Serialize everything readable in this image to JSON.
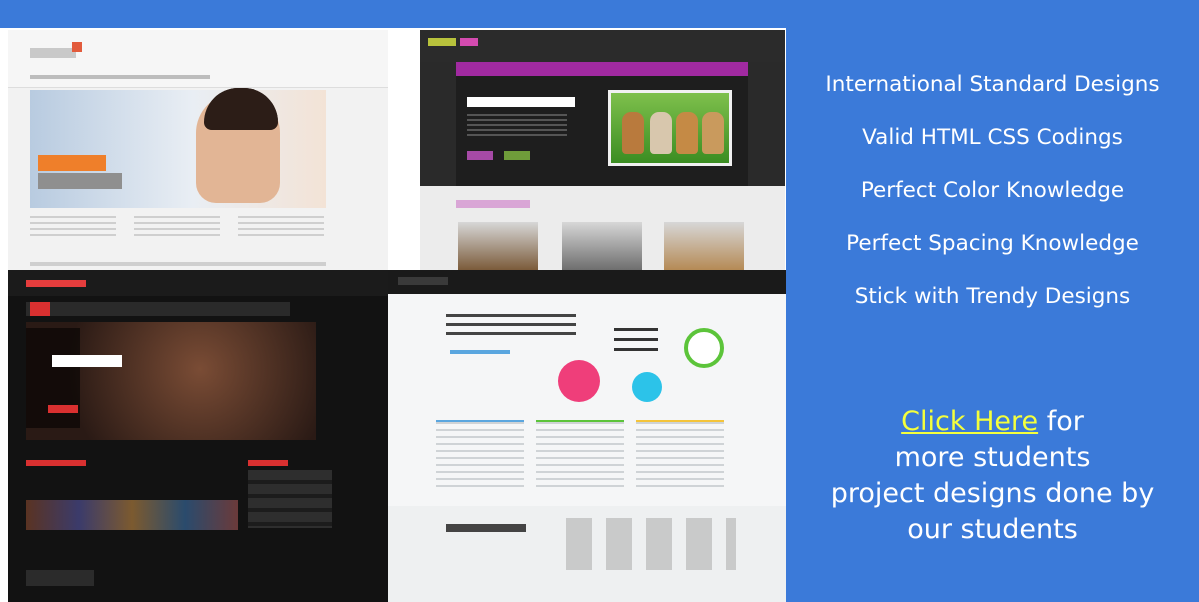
{
  "features": [
    "International Standard Designs",
    "Valid HTML CSS Codings",
    "Perfect Color Knowledge",
    "Perfect Spacing Knowledge",
    "Stick with Trendy Designs"
  ],
  "cta": {
    "link_text": "Click Here",
    "line1_rest": " for",
    "line2": "more students",
    "line3": "project designs done by",
    "line4": "our students"
  },
  "colors": {
    "background_blue": "#3b7ad9",
    "text": "#ffffff",
    "link": "#f4ff3c"
  }
}
